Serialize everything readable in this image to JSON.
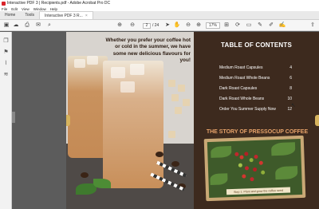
{
  "window": {
    "title": "Interactive PDF 3 | Recipients.pdf - Adobe Acrobat Pro DC"
  },
  "menu": [
    "File",
    "Edit",
    "View",
    "Window",
    "Help"
  ],
  "tabs": [
    {
      "label": "Home"
    },
    {
      "label": "Tools"
    },
    {
      "label": "Interactive PDF 3 R...",
      "close": "×"
    }
  ],
  "toolbar": {
    "page_current": "2",
    "page_total": "/ 24",
    "zoom": "17%"
  },
  "page": {
    "quote": "Whether you prefer your coffee hot or cold in the summer, we have some new delicious flavours for you!",
    "toc_title": "TABLE OF CONTENTS",
    "toc": [
      {
        "label": "Medium Roast Capsules",
        "page": "4"
      },
      {
        "label": "Medium Roast Whole Beans",
        "page": "6"
      },
      {
        "label": "Dark Roast Capsules",
        "page": "8"
      },
      {
        "label": "Dark Roast Whole Beans",
        "page": "10"
      },
      {
        "label": "Order You Summer Supply Now",
        "page": "12"
      }
    ],
    "story_title": "THE STORY OF PRESSOCUP COFFEE",
    "caption": "Step 1: Plant and grow the coffee seed"
  },
  "colors": {
    "brand_brown": "#3d2a1e",
    "accent_orange": "#e8a36a",
    "acrobat_red": "#d9242b"
  }
}
